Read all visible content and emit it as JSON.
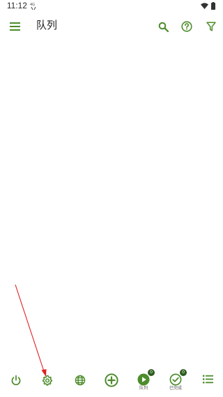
{
  "status_bar": {
    "time": "11:12",
    "icons": [
      "data-transfer-icon",
      "wifi-icon",
      "battery-icon"
    ]
  },
  "toolbar": {
    "title": "队列",
    "icons": [
      "menu-icon",
      "search-icon",
      "help-icon",
      "filter-icon"
    ]
  },
  "bottom_nav": {
    "items": [
      {
        "name": "power",
        "icon": "power-icon",
        "label": ""
      },
      {
        "name": "settings",
        "icon": "gear-icon",
        "label": ""
      },
      {
        "name": "globe",
        "icon": "globe-icon",
        "label": ""
      },
      {
        "name": "add",
        "icon": "add-circle-icon",
        "label": ""
      },
      {
        "name": "queue",
        "icon": "play-circle-icon",
        "label": "队列",
        "badge": "0"
      },
      {
        "name": "completed",
        "icon": "check-circle-icon",
        "label": "已完成",
        "badge": "0"
      },
      {
        "name": "list",
        "icon": "list-icon",
        "label": ""
      }
    ]
  },
  "colors": {
    "accent": "#4c8c2b",
    "badge": "#2e5c1f",
    "annotation": "#e02020"
  }
}
